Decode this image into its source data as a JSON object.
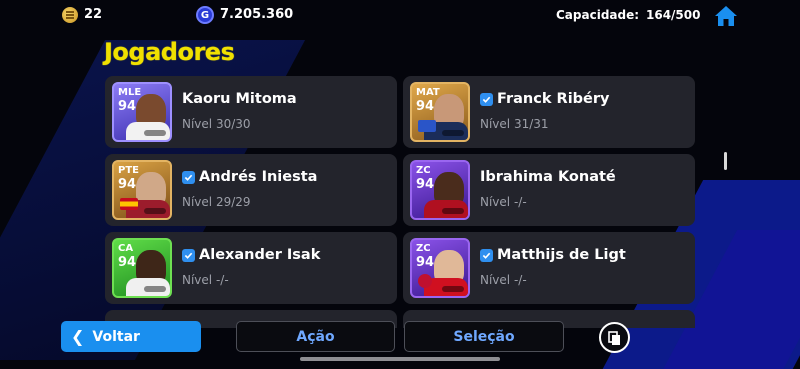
{
  "header": {
    "coins_value": "22",
    "gp_value": "7.205.360",
    "gp_letter": "G",
    "capacity_label": "Capacidade:",
    "capacity_value": "164/500",
    "icons": [
      "coin-icon",
      "gp-icon",
      "home-icon"
    ]
  },
  "title": "Jogadores",
  "players": [
    {
      "name": "Kaoru Mitoma",
      "level": "Nível 30/30",
      "position": "MLE",
      "ovr": "94",
      "verified": false,
      "frame_color": "#7b6cf0"
    },
    {
      "name": "Franck Ribéry",
      "level": "Nível 31/31",
      "position": "MAT",
      "ovr": "94",
      "verified": true,
      "frame_color": "#c9882e"
    },
    {
      "name": "Andrés Iniesta",
      "level": "Nível 29/29",
      "position": "PTE",
      "ovr": "94",
      "verified": true,
      "frame_color": "#c9882e"
    },
    {
      "name": "Ibrahima Konaté",
      "level": "Nível -/-",
      "position": "ZC",
      "ovr": "94",
      "verified": false,
      "frame_color": "#7b3fd8"
    },
    {
      "name": "Alexander Isak",
      "level": "Nível -/-",
      "position": "CA",
      "ovr": "94",
      "verified": true,
      "frame_color": "#46c93a"
    },
    {
      "name": "Matthijs de Ligt",
      "level": "Nível -/-",
      "position": "ZC",
      "ovr": "94",
      "verified": true,
      "frame_color": "#7b3fd8"
    }
  ],
  "buttons": {
    "back": "Voltar",
    "action": "Ação",
    "selection": "Seleção"
  },
  "colors": {
    "accent": "#1a8fef",
    "title": "#f0e000",
    "card_bg": "#23242c",
    "verified": "#2f8fef"
  }
}
